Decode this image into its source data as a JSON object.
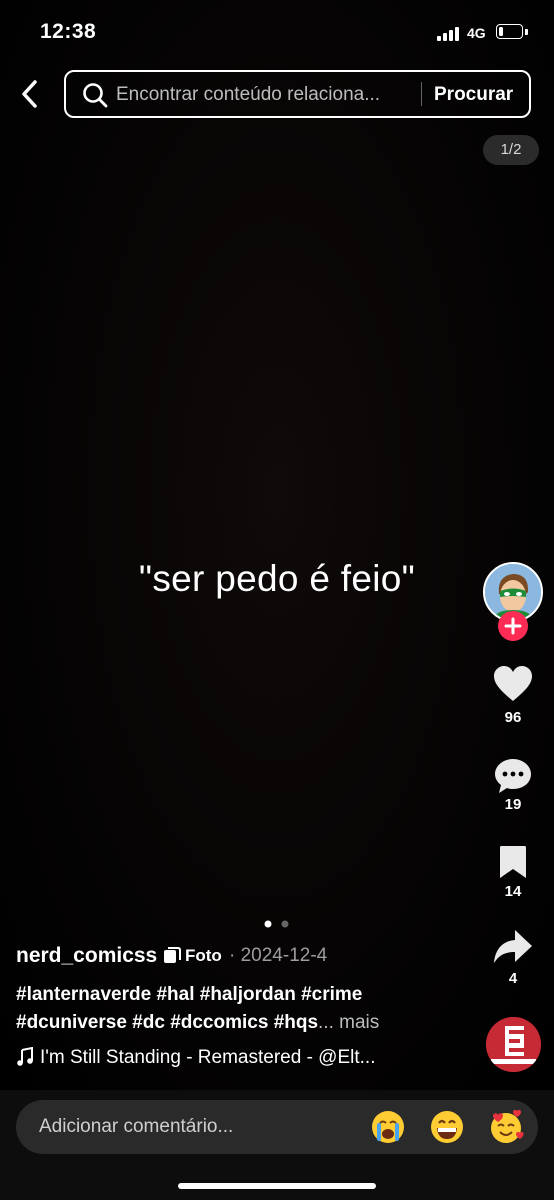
{
  "status_bar": {
    "time": "12:38",
    "network": "4G",
    "battery_level": 0.2
  },
  "search": {
    "placeholder": "Encontrar conteúdo relaciona...",
    "button_label": "Procurar"
  },
  "photo": {
    "counter": "1/2",
    "caption_text": "\"ser pedo é feio\""
  },
  "actions": {
    "likes": "96",
    "comments": "19",
    "saves": "14",
    "shares": "4"
  },
  "post": {
    "username": "nerd_comicss",
    "type_label": "Foto",
    "date": "· 2024-12-4",
    "hashtags_line1": "#lanternaverde #hal #haljordan #crime",
    "hashtags_line2": "#dcuniverse #dc #dccomics #hqs",
    "more_label": "... mais",
    "music": "I'm Still Standing - Remastered - @Elt..."
  },
  "comment_bar": {
    "placeholder": "Adicionar comentário..."
  },
  "colors": {
    "accent": "#fe2c55",
    "background": "#000000"
  },
  "icons": [
    "back-chevron-icon",
    "search-icon",
    "heart-icon",
    "comment-icon",
    "bookmark-icon",
    "share-icon",
    "music-note-icon",
    "plus-icon"
  ]
}
